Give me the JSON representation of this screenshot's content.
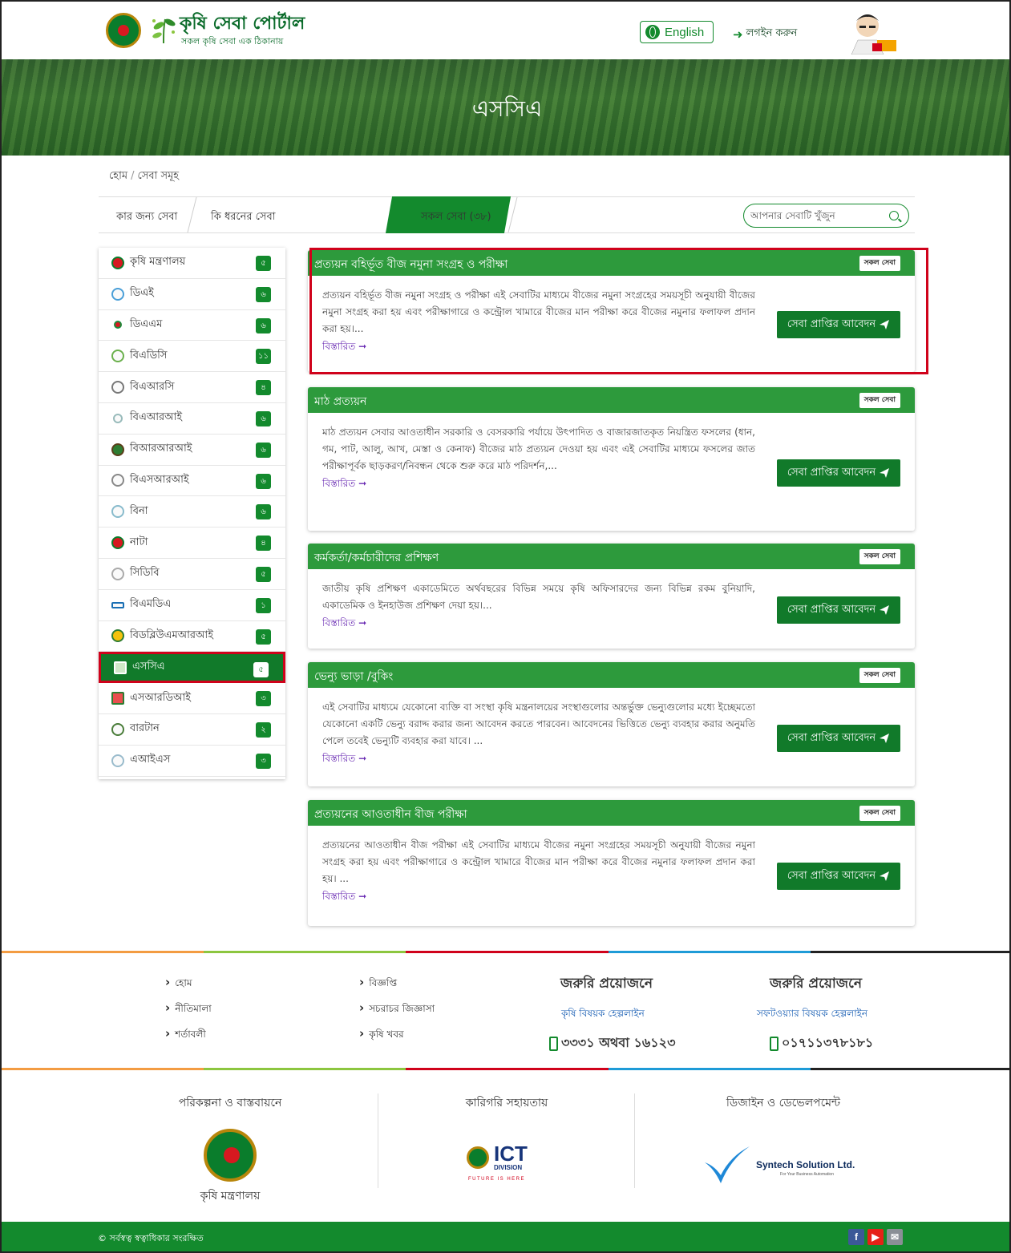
{
  "header": {
    "brand_title": "কৃষি সেবা পোর্টাল",
    "brand_subtitle": "সকল কৃষি সেবা এক ঠিকানায়",
    "lang_label": "English",
    "login_label": "লগইন করুন"
  },
  "banner": {
    "title": "এসসিএ"
  },
  "breadcrumb": {
    "home": "হোম",
    "separator": "/",
    "current": "সেবা সমূহ"
  },
  "tabs": [
    {
      "label": "কার জন্য সেবা"
    },
    {
      "label": "কি ধরনের সেবা"
    },
    {
      "label": "কোন দপ্তরের সেবা",
      "active": true
    },
    {
      "label": "সকল সেবা (৩৮)"
    }
  ],
  "search": {
    "placeholder": "আপনার সেবাটি খুঁজুন"
  },
  "sidebar": {
    "items": [
      {
        "label": "কৃষি মন্ত্রণালয়",
        "count": "৫"
      },
      {
        "label": "ডিএই",
        "count": "৬"
      },
      {
        "label": "ডিএএম",
        "count": "৬"
      },
      {
        "label": "বিএডিসি",
        "count": "১১"
      },
      {
        "label": "বিএআরসি",
        "count": "৪"
      },
      {
        "label": "বিএআরআই",
        "count": "৬"
      },
      {
        "label": "বিআরআরআই",
        "count": "৬"
      },
      {
        "label": "বিএসআরআই",
        "count": "৬"
      },
      {
        "label": "বিনা",
        "count": "৬"
      },
      {
        "label": "নাটা",
        "count": "৪"
      },
      {
        "label": "সিডিবি",
        "count": "৫"
      },
      {
        "label": "বিএমডিএ",
        "count": "১"
      },
      {
        "label": "বিডব্লিউএমআরআই",
        "count": "৫"
      },
      {
        "label": "এসসিএ",
        "count": "৫",
        "active": true
      },
      {
        "label": "এসআরডিআই",
        "count": "৩"
      },
      {
        "label": "বারটান",
        "count": "২"
      },
      {
        "label": "এআইএস",
        "count": "৩"
      }
    ]
  },
  "services": [
    {
      "title": "প্রত্যয়ন বহির্ভূত বীজ নমুনা সংগ্রহ ও পরীক্ষা",
      "badge": "সকল সেবা",
      "description": "প্রত্যয়ন বহির্ভূত বীজ নমুনা সংগ্রহ ও পরীক্ষা এই সেবাটির মাধ্যমে বীজের নমুনা সংগ্রহের সময়সূচী অনুযায়ী বীজের নমুনা সংগ্রহ করা হয় এবং পরীক্ষাগারে ও কন্ট্রোল খামারে বীজের মান পরীক্ষা করে বীজের নমুনার ফলাফল প্রদান করা হয়।...",
      "more": "বিস্তারিত",
      "apply": "সেবা প্রাপ্তির আবেদন"
    },
    {
      "title": "মাঠ প্রত্যয়ন",
      "badge": "সকল সেবা",
      "description": "মাঠ প্রত্যয়ন সেবার আওতাধীন সরকারি ও বেসরকারি পর্যায়ে উৎপাদিত ও বাজারজাতকৃত নিয়ন্ত্রিত ফসলের (ধান, গম, পাট, আলু, আখ, মেস্তা ও কেনাফ) বীজের মাঠ প্রত্যয়ন দেওয়া হয় এবং এই সেবাটির মাধ্যমে ফসলের জাত পরীক্ষাপূর্বক ছাড়করণ/নিবন্ধন থেকে শুরু করে মাঠ পরিদর্শন,...",
      "more": "বিস্তারিত",
      "apply": "সেবা প্রাপ্তির আবেদন"
    },
    {
      "title": "কর্মকর্তা/কর্মচারীদের প্রশিক্ষণ",
      "badge": "সকল সেবা",
      "description": "জাতীয় কৃষি প্রশিক্ষণ একাডেমিতে অর্থবছরের বিভিন্ন সময়ে কৃষি অফিসারদের জন্য বিভিন্ন রকম বুনিয়াদি, একাডেমিক ও ইনহাউজ প্রশিক্ষণ দেয়া হয়।...",
      "more": "বিস্তারিত",
      "apply": "সেবা প্রাপ্তির আবেদন"
    },
    {
      "title": "ভেন্যু ভাড়া /বুকিং",
      "badge": "সকল সেবা",
      "description": "এই সেবাটির মাধ্যমে যেকোনো ব্যক্তি বা সংস্থা কৃষি মন্ত্রনালয়ের সংস্থাগুলোর অন্তর্ভুক্ত ভেন্যুগুলোর মধ্যে ইচ্ছেমতো যেকোনো একটি ভেন্যু বরাদ্দ করার জন্য আবেদন করতে পারবেন। আবেদনের ভিত্তিতে ভেন্যু ব্যবহার করার অনুমতি পেলে তবেই ভেন্যুটি ব্যবহার করা যাবে। ...",
      "more": "বিস্তারিত",
      "apply": "সেবা প্রাপ্তির আবেদন"
    },
    {
      "title": "প্রত্যয়নের আওতাধীন বীজ পরীক্ষা",
      "badge": "সকল সেবা",
      "description": "প্রত্যয়নের আওতাধীন বীজ পরীক্ষা এই সেবাটির মাধ্যমে বীজের নমুনা সংগ্রহের সময়সূচী অনুযায়ী বীজের নমুনা সংগ্রহ করা হয় এবং পরীক্ষাগারে ও কন্ট্রোল খামারে বীজের মান পরীক্ষা করে বীজের নমুনার ফলাফল প্রদান করা হয়। ...",
      "more": "বিস্তারিত",
      "apply": "সেবা প্রাপ্তির আবেদন"
    }
  ],
  "footer": {
    "links_col1": [
      "হোম",
      "নীতিমালা",
      "শর্তাবলী"
    ],
    "links_col2": [
      "বিজ্ঞপ্তি",
      "সচরাচর জিজ্ঞাসা",
      "কৃষি খবর"
    ],
    "help1": {
      "title": "জরুরি প্রয়োজনে",
      "subtitle": "কৃষি বিষয়ক হেল্পলাইন",
      "phone": "৩৩৩১ অথবা ১৬১২৩"
    },
    "help2": {
      "title": "জরুরি প্রয়োজনে",
      "subtitle": "সফটওয়্যার বিষয়ক হেল্পলাইন",
      "phone": "০১৭১১৩৭৮১৮১"
    },
    "partners": {
      "planning_title": "পরিকল্পনা ও বাস্তবায়নে",
      "planning_name": "কৃষি মন্ত্রণালয়",
      "tech_title": "কারিগরি সহায়তায়",
      "ict_name": "ICT",
      "ict_sub": "DIVISION",
      "ict_tag": "FUTURE IS HERE",
      "design_title": "ডিজাইন ও ডেভেলপমেন্ট",
      "syntech_name": "Syntech Solution Ltd.",
      "syntech_tag": "For Your Business Automation"
    },
    "copyright": "© সর্বস্বত্ব স্বত্বাধিকার সংরক্ষিত"
  },
  "colors": {
    "brand_green": "#138a2d",
    "card_head_green": "#2d9a3c",
    "highlight_red": "#d0021b",
    "link_purple": "#6a2bb3"
  },
  "icons": {
    "search": "search-icon",
    "globe": "globe-icon",
    "login": "login-icon",
    "send": "paper-plane-icon",
    "arrow": "arrow-right-icon",
    "phone": "mobile-phone-icon"
  }
}
